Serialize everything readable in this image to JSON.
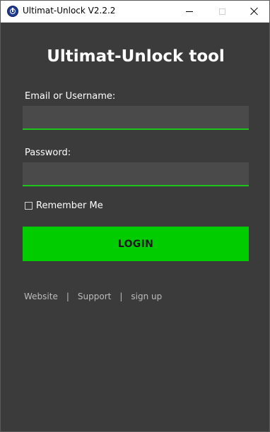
{
  "window": {
    "title": "Ultimat-Unlock V2.2.2",
    "app_icon": "app-logo-icon",
    "controls": {
      "minimize_icon": "minimize-icon",
      "maximize_icon": "maximize-icon",
      "close_icon": "close-icon"
    }
  },
  "form": {
    "heading": "Ultimat-Unlock tool",
    "email_label": "Email or Username:",
    "email_value": "",
    "email_placeholder": "",
    "password_label": "Password:",
    "password_value": "",
    "password_placeholder": "",
    "remember_label": "Remember Me",
    "remember_checked": false,
    "login_label": "LOGIN",
    "accent_color": "#00cc00"
  },
  "footer": {
    "links": [
      "Website",
      "Support",
      "sign up"
    ],
    "separator": "|"
  }
}
